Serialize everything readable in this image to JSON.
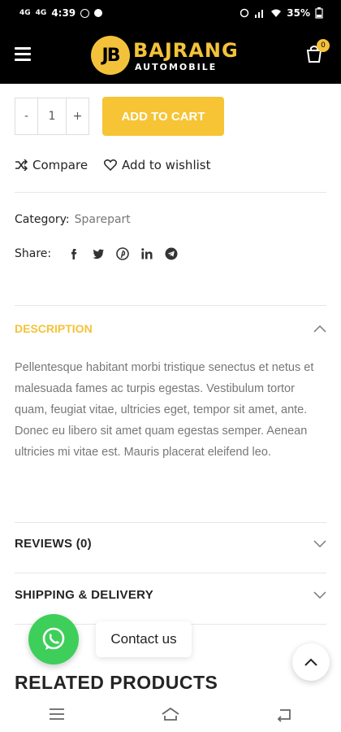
{
  "status": {
    "network_left": "4G",
    "network_left2": "4G",
    "time": "4:39",
    "battery": "35%"
  },
  "header": {
    "logo_mark": "JB",
    "logo_title": "BAJRANG",
    "logo_subtitle": "AUTOMOBILE",
    "cart_count": "0"
  },
  "product": {
    "qty_minus": "-",
    "qty_value": "1",
    "qty_plus": "+",
    "add_to_cart": "ADD TO CART",
    "compare": "Compare",
    "wishlist": "Add to wishlist",
    "category_label": "Category:",
    "category_value": "Sparepart",
    "share_label": "Share:"
  },
  "tabs": {
    "description_title": "DESCRIPTION",
    "description_text": "Pellentesque habitant morbi tristique senectus et netus et malesuada fames ac turpis egestas. Vestibulum tortor quam, feugiat vitae, ultricies eget, tempor sit amet, ante. Donec eu libero sit amet quam egestas semper. Aenean ultricies mi vitae est. Mauris placerat eleifend leo.",
    "reviews_title": "REVIEWS (0)",
    "shipping_title": "SHIPPING & DELIVERY"
  },
  "floating": {
    "contact_label": "Contact us"
  },
  "related_title": "RELATED PRODUCTS",
  "colors": {
    "accent": "#f4c23a",
    "whatsapp": "#3ecf5a",
    "header_bg": "#000000"
  }
}
